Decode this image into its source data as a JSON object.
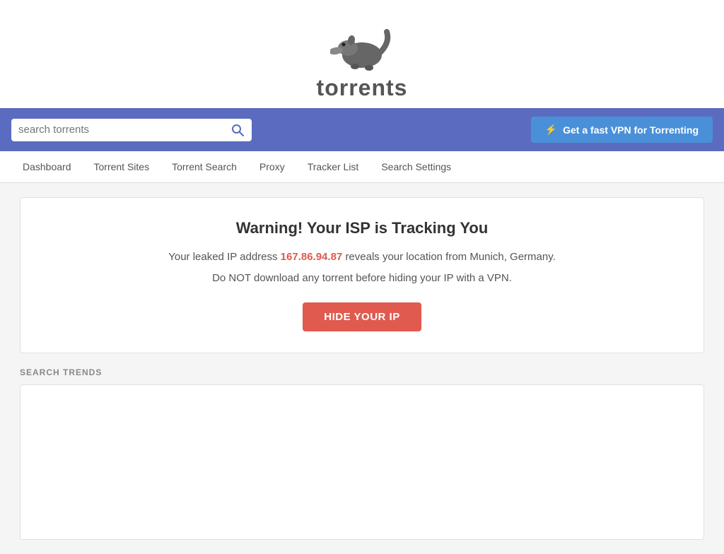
{
  "header": {
    "logo_alt": "Torrents logo - anteater",
    "logo_text": "torrents"
  },
  "search_bar": {
    "placeholder": "search torrents",
    "vpn_button_label": "Get a fast VPN for Torrenting",
    "vpn_icon": "⚡"
  },
  "nav": {
    "items": [
      {
        "label": "Dashboard",
        "id": "dashboard"
      },
      {
        "label": "Torrent Sites",
        "id": "torrent-sites"
      },
      {
        "label": "Torrent Search",
        "id": "torrent-search"
      },
      {
        "label": "Proxy",
        "id": "proxy"
      },
      {
        "label": "Tracker List",
        "id": "tracker-list"
      },
      {
        "label": "Search Settings",
        "id": "search-settings"
      }
    ]
  },
  "warning": {
    "title": "Warning! Your ISP is Tracking You",
    "line1_prefix": "Your leaked IP address",
    "ip_address": "167.86.94.87",
    "line1_suffix": "reveals your location from Munich, Germany.",
    "line2": "Do NOT download any torrent before hiding your IP with a VPN.",
    "button_label": "HIDE YOUR IP"
  },
  "trends": {
    "section_label": "SEARCH TRENDS"
  }
}
